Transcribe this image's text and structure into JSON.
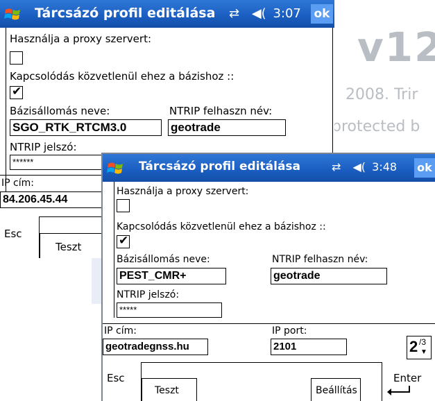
{
  "background": {
    "version_text": "v12",
    "copyright_text": "2008. Trir",
    "protected_text": "protected b"
  },
  "window_back": {
    "title": "Tárcsázó profil editálása",
    "time": "3:07",
    "ok_label": "ok",
    "proxy_label": "Használja a  proxy szervert:",
    "proxy_checked": false,
    "direct_label": "Kapcsolódás közvetlenül ehez a bázishoz ::",
    "direct_checked": true,
    "station_label": "Bázisállomás neve:",
    "station_value": "SGO_RTK_RTCM3.0",
    "ntrip_user_label": "NTRIP felhaszn név:",
    "ntrip_user_value": "geotrade",
    "ntrip_pass_label": "NTRIP jelszó:",
    "ntrip_pass_value": "******",
    "ip_label": "IP cím:",
    "ip_value": "84.206.45.44",
    "esc_label": "Esc",
    "test_label": "Teszt"
  },
  "window_front": {
    "title": "Tárcsázó profil editálása",
    "time": "3:48",
    "ok_label": "ok",
    "proxy_label": "Használja a  proxy szervert:",
    "proxy_checked": false,
    "direct_label": "Kapcsolódás közvetlenül ehez a bázishoz ::",
    "direct_checked": true,
    "station_label": "Bázisállomás neve:",
    "station_value": "PEST_CMR+",
    "ntrip_user_label": "NTRIP felhaszn név:",
    "ntrip_user_value": "geotrade",
    "ntrip_pass_label": "NTRIP jelszó:",
    "ntrip_pass_value": "*****",
    "ip_label": "IP cím:",
    "ip_value": "geotradegnss.hu",
    "port_label": "IP port:",
    "port_value": "2101",
    "page_current": "2",
    "page_total": "/3",
    "esc_label": "Esc",
    "test_label": "Teszt",
    "settings_label": "Beállítás",
    "enter_label": "Enter"
  },
  "colors": {
    "titlebar": "#1b5fc2",
    "ok_button": "#5a9df2",
    "background_text": "#b9bec4"
  },
  "icons": [
    "windows-flag-icon",
    "connectivity-icon",
    "speaker-icon",
    "check-icon",
    "down-arrow-icon",
    "enter-arrow-icon"
  ]
}
